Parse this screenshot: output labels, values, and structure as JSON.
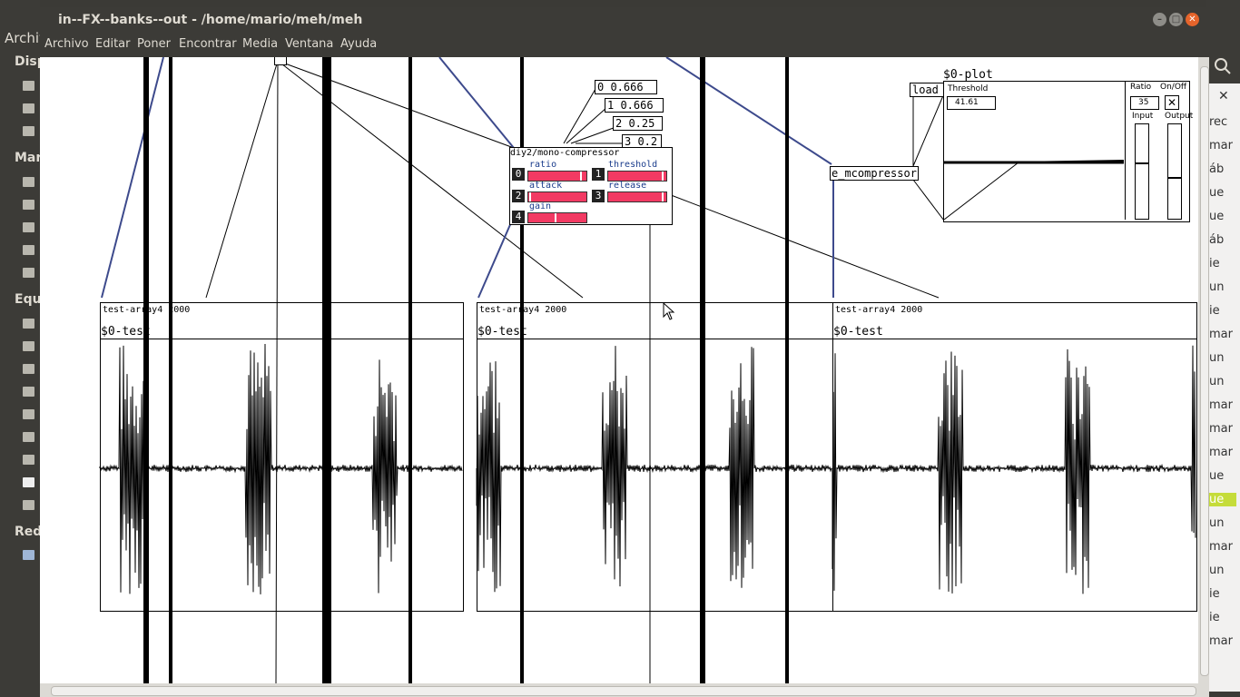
{
  "window": {
    "title": "in--FX--banks--out  - /home/mario/meh/meh"
  },
  "menu": [
    "Archivo",
    "Editar",
    "Poner",
    "Encontrar",
    "Media",
    "Ventana",
    "Ayuda"
  ],
  "background_left": {
    "archivo": "Archiv",
    "sections": [
      "Disp",
      "Mar",
      "Equ",
      "Red"
    ]
  },
  "background_right": {
    "rows": [
      "rec",
      "mar",
      "áb",
      "ue",
      "ue",
      "áb",
      "ie",
      "un",
      "ie",
      "mar",
      "un",
      "un",
      "mar",
      "mar",
      "mar",
      "ue",
      "ue",
      "un",
      "mar",
      "un",
      "ie",
      "ie",
      "mar"
    ],
    "highlight_row": 16
  },
  "patch": {
    "messages": [
      "0 0.666",
      "1 0.666",
      "2 0.25",
      "3 0.2"
    ],
    "compressor": {
      "title": "diy2/mono-compressor",
      "params": [
        {
          "index": "0",
          "label": "ratio",
          "level": 0.95
        },
        {
          "index": "1",
          "label": "threshold",
          "level": 0.98
        },
        {
          "index": "2",
          "label": "attack",
          "level": 0.02
        },
        {
          "index": "3",
          "label": "release",
          "level": 0.98
        },
        {
          "index": "4",
          "label": "gain",
          "level": 0.48
        }
      ]
    },
    "load": "load",
    "e_mcompressor": "e_mcompressor",
    "plot": {
      "name": "$0-plot",
      "threshold_label": "Threshold",
      "threshold_value": "41.61",
      "ratio_label": "Ratio",
      "ratio_value": "35",
      "onoff_label": "On/Off",
      "input_label": "Input",
      "output_label": "Output"
    },
    "arrays": [
      {
        "header": "test-array4 2000",
        "name": "$0-test"
      },
      {
        "header": "test-array4 2000",
        "name": "$0-test"
      },
      {
        "header": "test-array4 2000",
        "name": "$0-test"
      }
    ]
  },
  "colors": {
    "slider": "#f23a63",
    "chrome": "#3c3b37",
    "cord": "#3d4a8c"
  }
}
